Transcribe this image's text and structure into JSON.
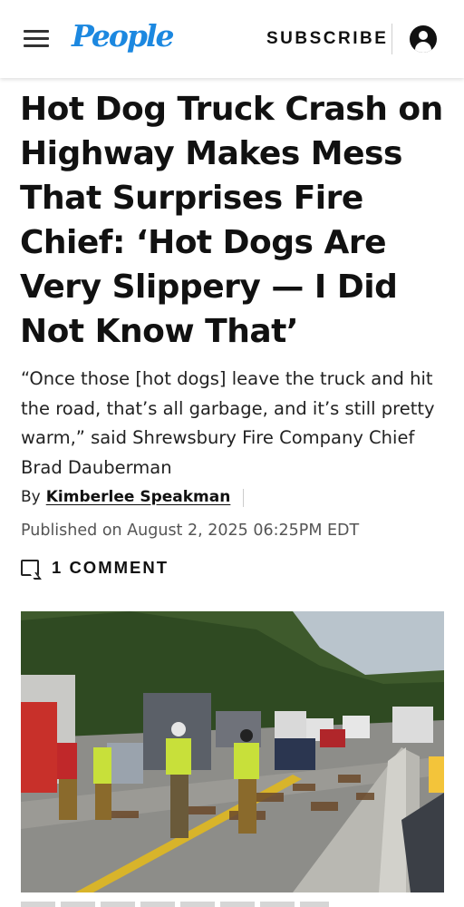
{
  "header": {
    "logo": "People",
    "subscribe_label": "SUBSCRIBE",
    "menu_icon": "hamburger-menu-icon",
    "account_icon": "user-account-icon",
    "logo_color": "#1c88e0"
  },
  "article": {
    "headline": "Hot Dog Truck Crash on Highway Makes Mess That Surprises Fire Chief: ‘Hot Dogs Are Very Slippery — I Did Not Know That’",
    "dek": "“Once those [hot dogs] leave the truck and hit the road, that’s all garbage, and it’s still pretty warm,” said Shrewsbury Fire Company Chief Brad Dauberman",
    "byline_prefix": "By",
    "author": "Kimberlee Speakman",
    "published": "Published on August 2, 2025 06:25PM EDT",
    "comment_count": "1",
    "comment_label": "COMMENT",
    "comment_icon": "comment-bubble-icon"
  },
  "photo": {
    "description_icon": "highway-crash-photo"
  }
}
